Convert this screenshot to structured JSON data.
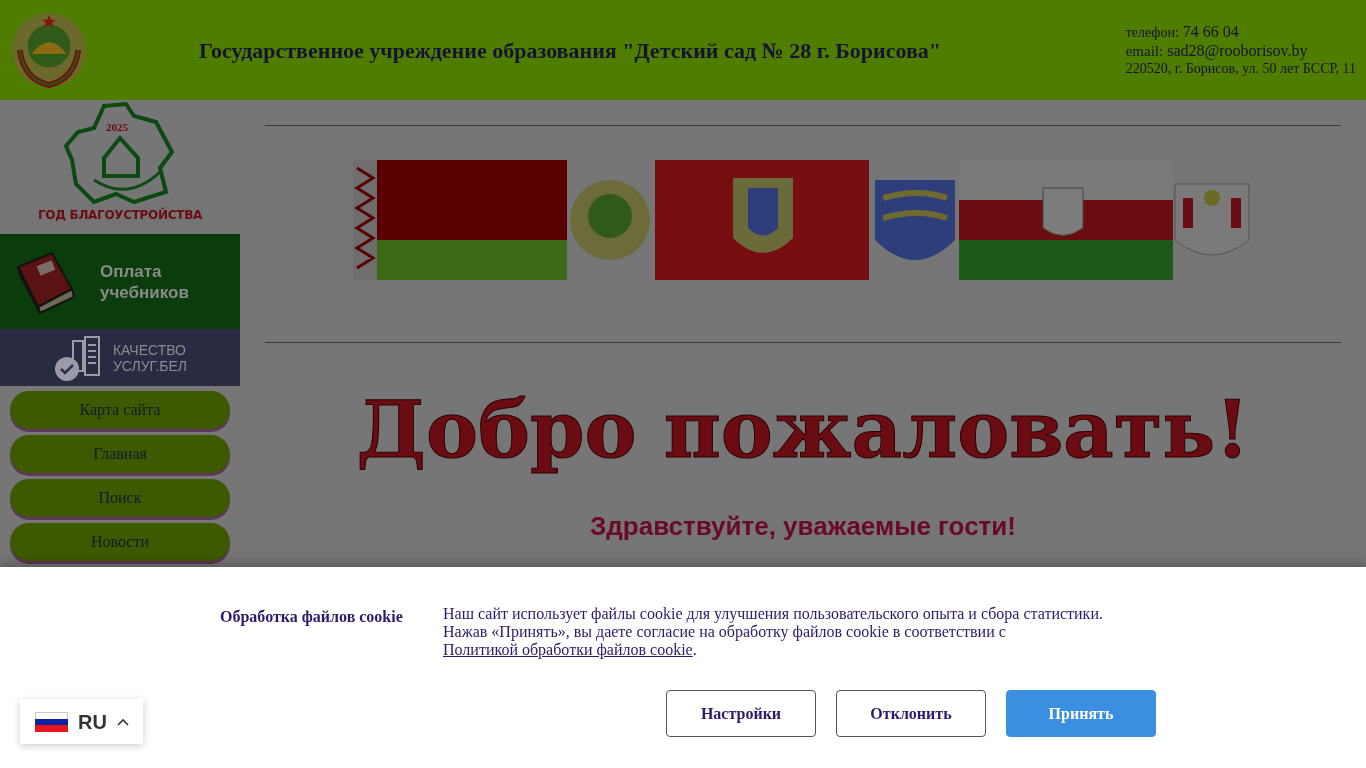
{
  "header": {
    "title": "Государственное учреждение образования \"Детский сад № 28 г. Борисова\"",
    "phone_label": "телефон:",
    "phone": "74 66 04",
    "email_label": "email:",
    "email": "sad28@rooborisov.by",
    "address": "220520, г. Борисов, ул. 50 лет БССР, 11"
  },
  "sidebar": {
    "year_logo": {
      "year": "2025",
      "caption": "ГОД БЛАГОУСТРОЙСТВА"
    },
    "textbook_banner": [
      "Оплата",
      "учебников"
    ],
    "quality_banner": [
      "КАЧЕСТВО",
      "УСЛУГ.БЕЛ"
    ],
    "menu": [
      "Карта сайта",
      "Главная",
      "Поиск",
      "Новости"
    ]
  },
  "main": {
    "welcome_title": "Добро пожаловать!",
    "greeting": "Здравствуйте, уважаемые гости!"
  },
  "cookie_banner": {
    "title": "Обработка файлов cookie",
    "text": "Наш сайт использует файлы cookie для улучшения пользовательского опыта и сбора статистики. Нажав «Принять», вы даете согласие на обработку файлов cookie в соответствии с",
    "link": "Политикой обработки файлов cookie",
    "text_end": ".",
    "buttons": [
      {
        "label": "Настройки",
        "kind": "outline"
      },
      {
        "label": "Отклонить",
        "kind": "outline"
      },
      {
        "label": "Принять",
        "kind": "primary"
      }
    ]
  },
  "language": {
    "code": "RU"
  }
}
